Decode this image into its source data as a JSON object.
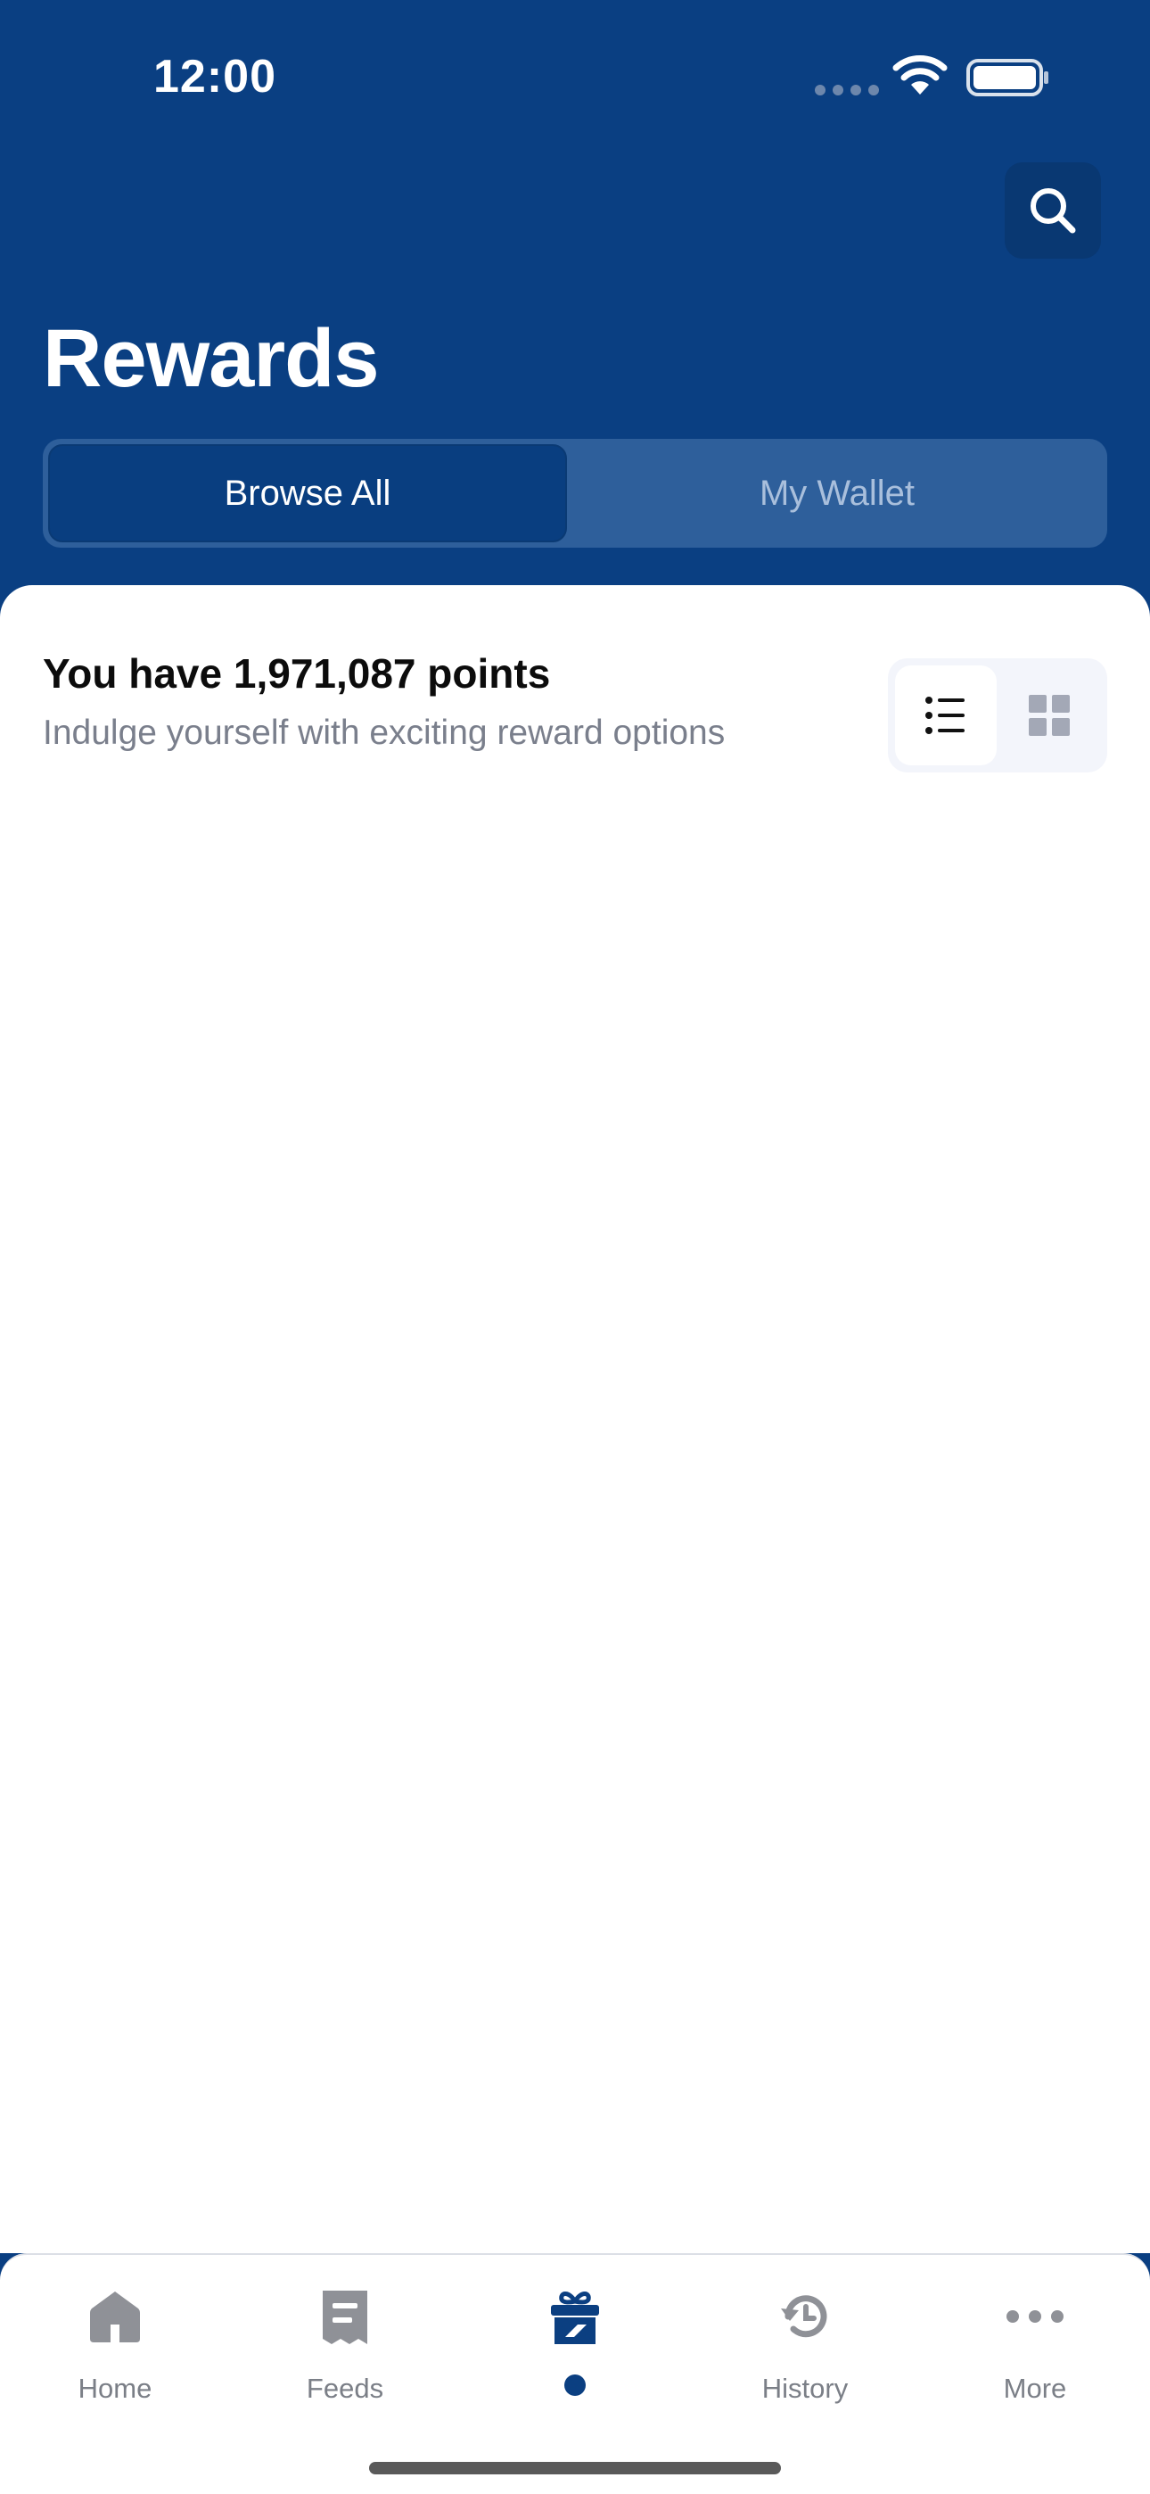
{
  "status_bar": {
    "time": "12:00"
  },
  "header": {
    "title": "Rewards",
    "search_icon": "search-icon",
    "segments": {
      "active": "Browse All",
      "inactive": "My Wallet"
    }
  },
  "summary": {
    "points_text": "You have 1,971,087 points",
    "subtitle": "Indulge yourself with exciting reward options"
  },
  "view_toggle": {
    "options": [
      "list-view-icon",
      "grid-view-icon"
    ],
    "selected": "list-view-icon"
  },
  "tabbar": {
    "items": [
      {
        "label": "Home",
        "icon": "home-icon"
      },
      {
        "label": "Feeds",
        "icon": "feeds-icon"
      },
      {
        "label": "",
        "icon": "gift-icon",
        "active": true
      },
      {
        "label": "History",
        "icon": "history-icon"
      },
      {
        "label": "More",
        "icon": "more-icon"
      }
    ]
  },
  "colors": {
    "brand": "#0a3f82",
    "inactive_icon": "#8f9197",
    "background": "#ffffff"
  }
}
